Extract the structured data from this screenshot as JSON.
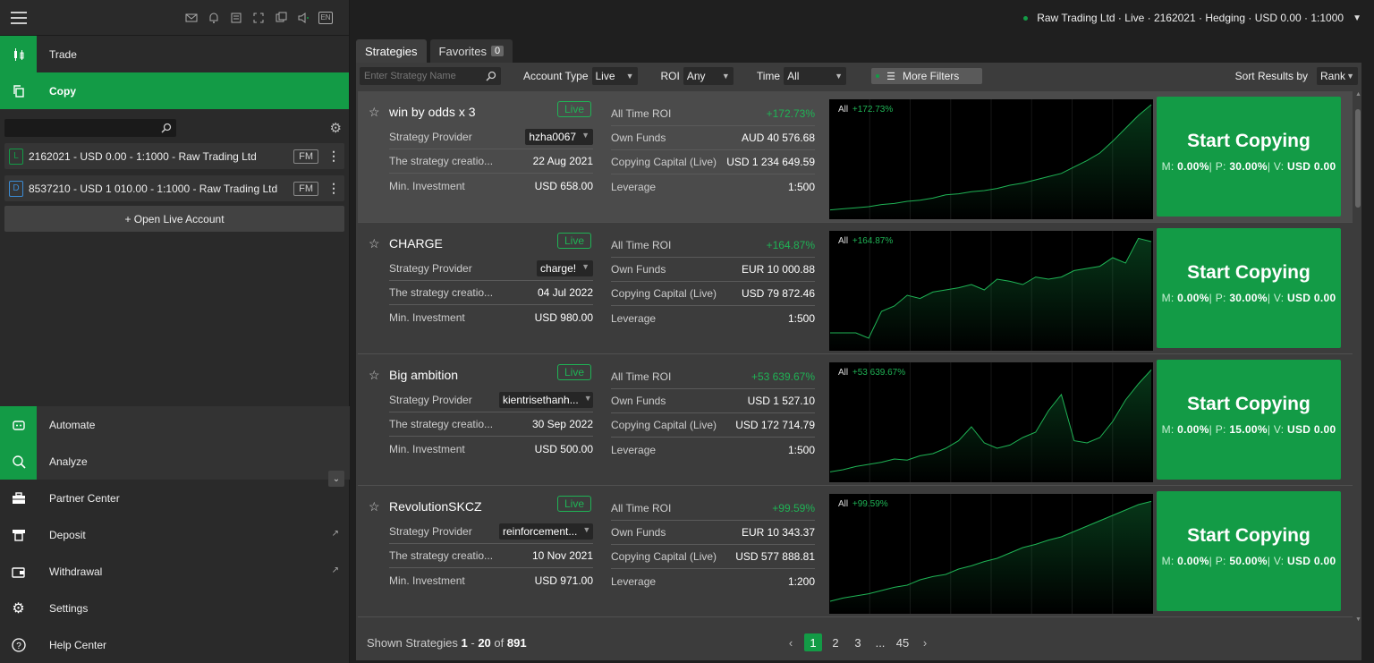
{
  "header": {
    "account_info": "Raw Trading Ltd · Live · 2162021 · Hedging · USD 0.00 · 1:1000",
    "status_color": "#139b46"
  },
  "sidebar": {
    "lang": "EN",
    "nav_top": [
      {
        "label": "Trade",
        "icon": "candlestick-icon"
      },
      {
        "label": "Copy",
        "icon": "copy-icon"
      }
    ],
    "accounts": [
      {
        "type": "L",
        "label": "2162021 - USD 0.00 - 1:1000 - Raw Trading Ltd",
        "tag": "FM"
      },
      {
        "type": "D",
        "label": "8537210 - USD 1 010.00 - 1:1000 - Raw Trading Ltd",
        "tag": "FM"
      }
    ],
    "open_account": "+ Open Live Account",
    "nav_bottom": [
      {
        "label": "Automate",
        "icon": "robot-icon"
      },
      {
        "label": "Analyze",
        "icon": "analyze-icon"
      },
      {
        "label": "Partner Center",
        "icon": "briefcase-icon"
      },
      {
        "label": "Deposit",
        "icon": "deposit-icon"
      },
      {
        "label": "Withdrawal",
        "icon": "wallet-icon"
      },
      {
        "label": "Settings",
        "icon": "gear-icon"
      },
      {
        "label": "Help Center",
        "icon": "help-icon"
      }
    ]
  },
  "tabs": {
    "strategies": "Strategies",
    "favorites": "Favorites",
    "favorites_count": "0"
  },
  "filters": {
    "search_placeholder": "Enter Strategy Name",
    "account_type_label": "Account Type",
    "account_type_value": "Live",
    "roi_label": "ROI",
    "roi_value": "Any",
    "time_label": "Time",
    "time_value": "All",
    "more_filters": "More Filters",
    "sort_label": "Sort Results by",
    "sort_value": "Rank"
  },
  "labels": {
    "provider": "Strategy Provider",
    "creation": "The strategy creatio...",
    "min_investment": "Min. Investment",
    "all_time_roi": "All Time ROI",
    "own_funds": "Own Funds",
    "copying_capital": "Copying Capital (Live)",
    "leverage": "Leverage",
    "live": "Live",
    "start_copying": "Start Copying",
    "chart_period": "All"
  },
  "strategies": [
    {
      "name": "win by odds x 3",
      "provider": "hzha0067",
      "created": "22 Aug 2021",
      "min_investment": "USD 658.00",
      "roi": "+172.73%",
      "own_funds": "AUD 40 576.68",
      "copying_capital": "USD 1 234 649.59",
      "leverage": "1:500",
      "fees_m": "0.00%",
      "fees_p": "30.00%",
      "fees_v": "USD 0.00",
      "equity": [
        0.02,
        0.03,
        0.04,
        0.05,
        0.07,
        0.08,
        0.1,
        0.11,
        0.13,
        0.16,
        0.17,
        0.19,
        0.2,
        0.22,
        0.25,
        0.27,
        0.3,
        0.33,
        0.36,
        0.42,
        0.48,
        0.55,
        0.66,
        0.78,
        0.9,
        1.0
      ]
    },
    {
      "name": "CHARGE",
      "provider": "charge!",
      "created": "04 Jul 2022",
      "min_investment": "USD 980.00",
      "roi": "+164.87%",
      "own_funds": "EUR 10 000.88",
      "copying_capital": "USD 79 872.46",
      "leverage": "1:500",
      "fees_m": "0.00%",
      "fees_p": "30.00%",
      "fees_v": "USD 0.00",
      "equity": [
        0.1,
        0.1,
        0.1,
        0.05,
        0.3,
        0.35,
        0.45,
        0.42,
        0.48,
        0.5,
        0.52,
        0.55,
        0.5,
        0.6,
        0.58,
        0.55,
        0.62,
        0.6,
        0.62,
        0.68,
        0.7,
        0.72,
        0.8,
        0.75,
        0.98,
        0.95
      ]
    },
    {
      "name": "Big ambition",
      "provider": "kientrisethanh...",
      "created": "30 Sep 2022",
      "min_investment": "USD 500.00",
      "roi": "+53 639.67%",
      "own_funds": "USD 1 527.10",
      "copying_capital": "USD 172 714.79",
      "leverage": "1:500",
      "fees_m": "0.00%",
      "fees_p": "15.00%",
      "fees_v": "USD 0.00",
      "equity": [
        0.03,
        0.05,
        0.08,
        0.1,
        0.12,
        0.15,
        0.14,
        0.18,
        0.2,
        0.25,
        0.32,
        0.45,
        0.3,
        0.25,
        0.28,
        0.35,
        0.4,
        0.6,
        0.75,
        0.32,
        0.3,
        0.35,
        0.5,
        0.7,
        0.85,
        0.98
      ]
    },
    {
      "name": "RevolutionSKCZ",
      "provider": "reinforcement...",
      "created": "10 Nov 2021",
      "min_investment": "USD 971.00",
      "roi": "+99.59%",
      "own_funds": "EUR 10 343.37",
      "copying_capital": "USD 577 888.81",
      "leverage": "1:200",
      "fees_m": "0.00%",
      "fees_p": "50.00%",
      "fees_v": "USD 0.00",
      "equity": [
        0.05,
        0.08,
        0.1,
        0.12,
        0.15,
        0.18,
        0.2,
        0.25,
        0.28,
        0.3,
        0.35,
        0.38,
        0.42,
        0.45,
        0.5,
        0.55,
        0.58,
        0.62,
        0.65,
        0.7,
        0.75,
        0.8,
        0.85,
        0.9,
        0.95,
        0.98
      ]
    }
  ],
  "footer": {
    "shown_label": "Shown Strategies",
    "from": "1",
    "to": "20",
    "of_label": "of",
    "total": "891",
    "pages": [
      "1",
      "2",
      "3",
      "...",
      "45"
    ],
    "current_page": "1"
  },
  "colors": {
    "accent": "#139b46",
    "roi_positive": "#1fb355"
  }
}
